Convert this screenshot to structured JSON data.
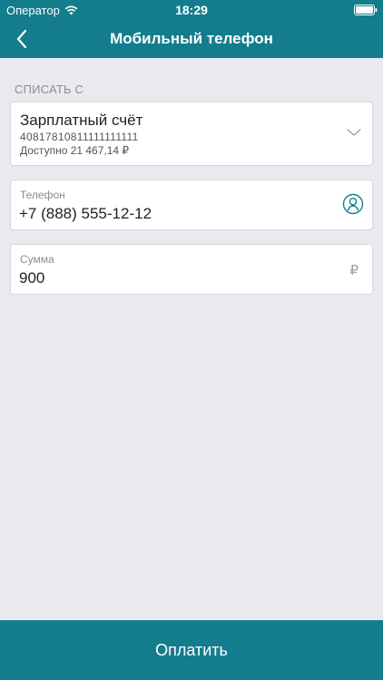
{
  "status_bar": {
    "carrier": "Оператор",
    "time": "18:29"
  },
  "nav": {
    "title": "Мобильный телефон"
  },
  "source": {
    "section_label": "СПИСАТЬ С",
    "account_name": "Зарплатный счёт",
    "account_number": "40817810811111111111",
    "available": "Доступно 21 467,14 ₽"
  },
  "phone": {
    "label": "Телефон",
    "value": "+7 (888) 555-12-12"
  },
  "sum": {
    "label": "Сумма",
    "value": "900",
    "currency": "₽"
  },
  "actions": {
    "pay_label": "Оплатить"
  },
  "colors": {
    "accent": "#137d8d",
    "background": "#e9eaef"
  },
  "icons": {
    "back": "chevron-left-icon",
    "wifi": "wifi-icon",
    "battery": "battery-icon",
    "dropdown": "chevron-down-icon",
    "contacts": "contact-person-icon"
  }
}
